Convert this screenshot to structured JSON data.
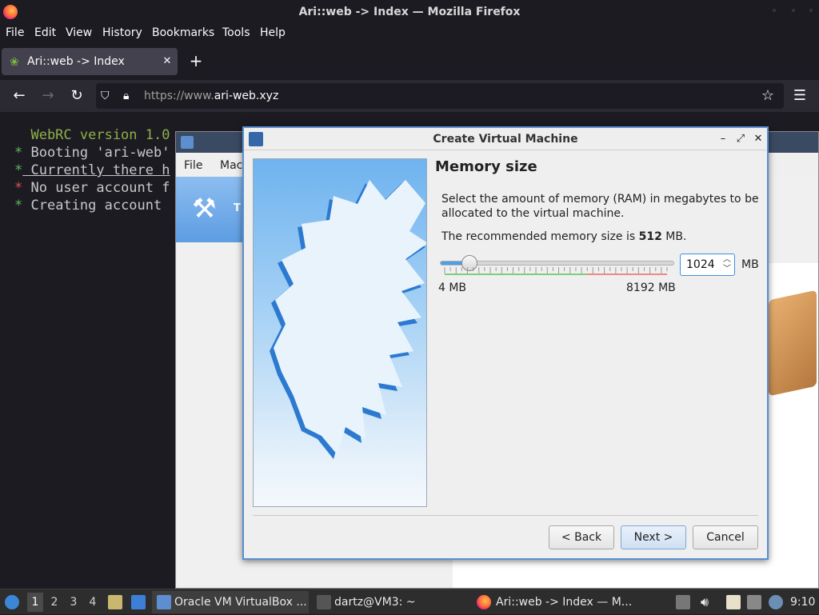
{
  "firefox": {
    "window_title": "Ari::web -> Index — Mozilla Firefox",
    "menu": [
      "File",
      "Edit",
      "View",
      "History",
      "Bookmarks",
      "Tools",
      "Help"
    ],
    "tab_title": "Ari::web -> Index",
    "url_prefix": "https://www.",
    "url_domain": "ari-web.xyz"
  },
  "terminal": {
    "lines": [
      {
        "bullet": "",
        "text": "  WebRC version 1.0"
      },
      {
        "bullet": "*",
        "text": " Booting 'ari-web'"
      },
      {
        "bullet": "*",
        "text": " Currently there h"
      },
      {
        "bullet": "*",
        "text": " No user account f"
      },
      {
        "bullet": "*",
        "text": " Creating account"
      }
    ]
  },
  "vbox_manager": {
    "menu": [
      "File",
      "Mac"
    ],
    "tool_label": "T"
  },
  "dialog": {
    "title": "Create Virtual Machine",
    "heading": "Memory size",
    "description": "Select the amount of memory (RAM) in megabytes to be allocated to the virtual machine.",
    "recommend_prefix": "The recommended memory size is ",
    "recommend_value": "512",
    "recommend_suffix": " MB.",
    "memory_value": "1024",
    "memory_unit": "MB",
    "slider_min_label": "4 MB",
    "slider_max_label": "8192 MB",
    "slider_fraction": 0.125,
    "buttons": {
      "back": "< Back",
      "next": "Next >",
      "cancel": "Cancel"
    }
  },
  "taskbar": {
    "workspaces": [
      "1",
      "2",
      "3",
      "4"
    ],
    "tasks": [
      "Oracle VM VirtualBox ...",
      "dartz@VM3: ~",
      "Ari::web -> Index — M..."
    ],
    "clock": "9:10"
  }
}
